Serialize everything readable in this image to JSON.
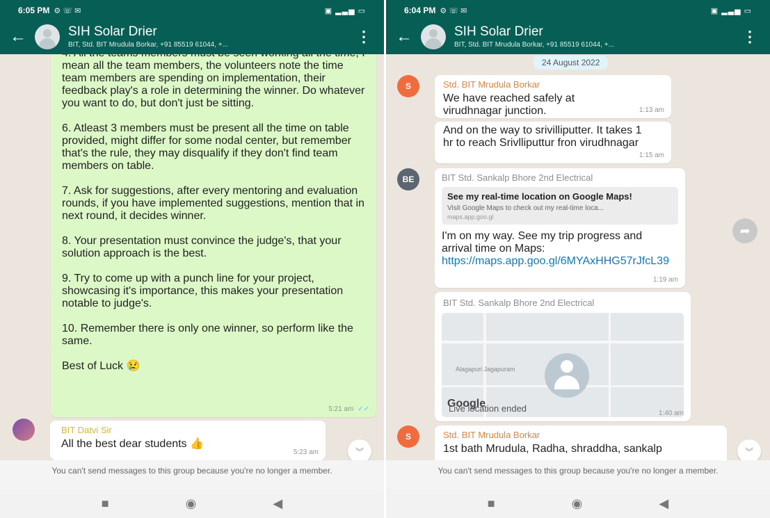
{
  "left": {
    "status": {
      "time": "6:05 PM",
      "icons": "⚙ ☏ ✉",
      "right": "▣ ▂▃▅ ▭"
    },
    "header": {
      "title": "SIH Solar Drier",
      "subtitle": "BIT, Std. BIT Mrudula Borkar, +91 85519 61044, +..."
    },
    "messages": {
      "main_text_0": "4. All the teams members must be seen working all the time, I mean all the team members, the volunteers note the time team members are spending on implementation, their feedback play's a role in determining the winner. Do whatever you want to do, but don't just be sitting.",
      "main_text_1": "6. Atleast 3 members must be present all the time on table provided, might differ for some nodal center, but remember that's the rule, they may disqualify if they don't find team members on table.",
      "main_text_2": "7. Ask for suggestions, after every mentoring and evaluation rounds, if you have implemented suggestions, mention that in next round, it decides winner.",
      "main_text_3": "8. Your presentation must convince the judge's, that your solution approach is the best.",
      "main_text_4": "9. Try to come up with a punch line for your project, showcasing it's importance, this makes your presentation notable to judge's.",
      "main_text_5": "10. Remember there is only one winner, so perform like the same.",
      "main_text_6": "Best of Luck 😢",
      "main_time": "5:21 am",
      "ticks": "✓✓",
      "m2_sender": "BIT Datvi Sir",
      "m2_text": "All the best dear students 👍",
      "m2_time": "5:23 am"
    },
    "footer": "You can't send messages to this group because you're no longer a member.",
    "scroll_icon": "︾"
  },
  "right": {
    "status": {
      "time": "6:04 PM",
      "icons": "⚙ ☏ ✉",
      "right": "▣ ▂▃▅ ▭"
    },
    "header": {
      "title": "SIH Solar Drier",
      "subtitle": "BIT, Std. BIT Mrudula Borkar, +91 85519 61044, +..."
    },
    "date": "24 August 2022",
    "messages": {
      "m1_avatar": "S",
      "m1_sender": "Std. BIT Mrudula Borkar",
      "m1_text": "We have reached safely at virudhnagar junction.",
      "m1_time": "1:13 am",
      "m2_text": "And on the way to srivilliputter. It takes 1 hr to reach Srivlliputtur fron virudhnagar",
      "m2_time": "1:15 am",
      "m3_avatar": "BE",
      "m3_sender": "BIT Std. Sankalp Bhore 2nd Electrical",
      "m3_link_title": "See my real-time location on Google Maps!",
      "m3_link_desc": "Visit Google Maps to check out my real-time loca...",
      "m3_link_url": "maps.app.goo.gl",
      "m3_text": "I'm on my way. See my trip progress and arrival time on Maps: ",
      "m3_link": "https://maps.app.goo.gl/6MYAxHHG57rJfcL39",
      "m3_time": "1:19 am",
      "m4_sender": "BIT Std. Sankalp Bhore 2nd Electrical",
      "m4_map_place": "Alagapuri Jagapuram",
      "m4_google": "Google",
      "m4_caption": "Live location ended",
      "m4_time": "1:40 am",
      "m5_avatar": "S",
      "m5_sender": "Std. BIT Mrudula Borkar",
      "m5_text": "1st bath Mrudula, Radha, shraddha, sankalp"
    },
    "footer": "You can't send messages to this group because you're no longer a member.",
    "scroll_icon": "︾",
    "forward_icon": "➦"
  },
  "nav": {
    "square": "■",
    "circle": "◉",
    "back": "◀"
  },
  "colors": {
    "header": "#075e54",
    "outgoing": "#dcf8c6",
    "incoming": "#ffffff",
    "chat_bg": "#ece5dd",
    "link": "#0b7bc1",
    "sender_orange": "#e8823a",
    "sender_yellow": "#d8b63a"
  }
}
